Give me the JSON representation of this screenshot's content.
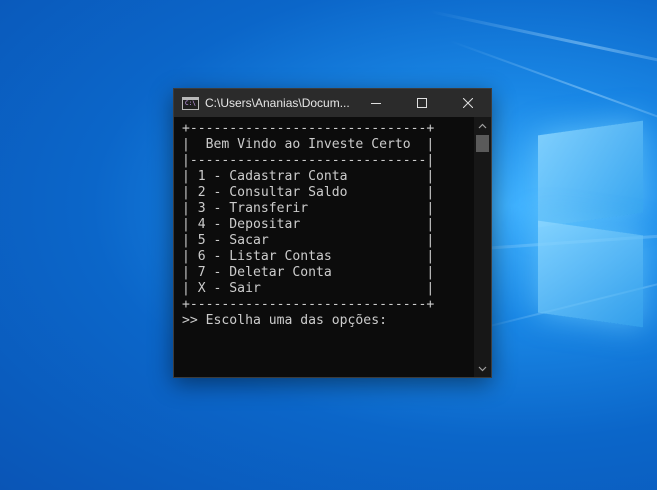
{
  "desktop": {
    "wallpaper": "windows-10-hero-wallpaper",
    "accent": "#0b66c9"
  },
  "window": {
    "title": "C:\\Users\\Ananias\\Docum...",
    "icon": "console-app-icon",
    "controls": {
      "minimize": "minimize-icon",
      "maximize": "maximize-icon",
      "close": "close-icon"
    }
  },
  "console": {
    "lines": [
      "+------------------------------+",
      "|  Bem Vindo ao Investe Certo  |",
      "|------------------------------|",
      "| 1 - Cadastrar Conta          |",
      "| 2 - Consultar Saldo          |",
      "| 3 - Transferir               |",
      "| 4 - Depositar                |",
      "| 5 - Sacar                    |",
      "| 6 - Listar Contas            |",
      "| 7 - Deletar Conta            |",
      "| X - Sair                     |",
      "+------------------------------+",
      ">> Escolha uma das opções:"
    ],
    "text_color": "#cccccc",
    "background": "#0c0c0c"
  }
}
